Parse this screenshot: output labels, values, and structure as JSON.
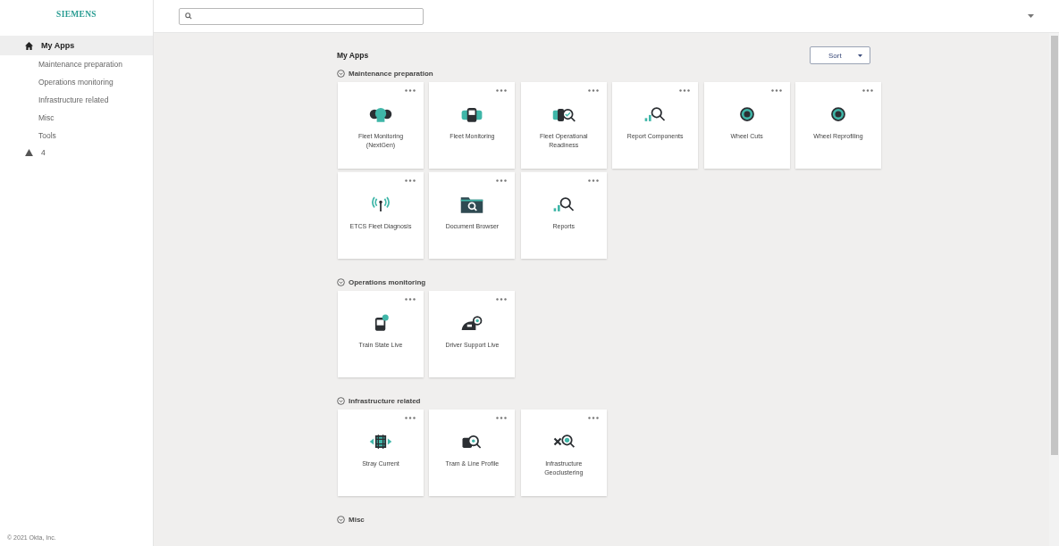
{
  "sidebar": {
    "logo": "SIEMENS",
    "items": [
      {
        "label": "My Apps",
        "selected": true,
        "children": [
          {
            "label": "Maintenance preparation",
            "selected": false
          },
          {
            "label": "Operations monitoring",
            "selected": false
          },
          {
            "label": "Infrastructure related",
            "selected": false
          },
          {
            "label": "Misc",
            "selected": false
          },
          {
            "label": "Tools",
            "selected": false
          }
        ]
      }
    ],
    "alerts": {
      "count": "4"
    },
    "footer": "© 2021 Okta, Inc."
  },
  "main": {
    "title": "My Apps",
    "sort_button": "Sort",
    "sections": [
      {
        "title": "Maintenance preparation",
        "apps": [
          {
            "label": "Fleet Monitoring (NextGen)"
          },
          {
            "label": "Fleet Monitoring"
          },
          {
            "label": "Fleet Operational Readiness"
          },
          {
            "label": "Report Components"
          },
          {
            "label": "Wheel Cuts"
          },
          {
            "label": "Wheel Reprofiling"
          },
          {
            "label": "ETCS Fleet Diagnosis"
          },
          {
            "label": "Document Browser"
          },
          {
            "label": "Reports"
          }
        ]
      },
      {
        "title": "Operations monitoring",
        "apps": [
          {
            "label": "Train State Live"
          },
          {
            "label": "Driver Support Live"
          }
        ]
      },
      {
        "title": "Infrastructure related",
        "apps": [
          {
            "label": "Stray Current"
          },
          {
            "label": "Tram & Line Profile"
          },
          {
            "label": "Infrastructure Geoclustering"
          }
        ]
      },
      {
        "title": "Misc"
      }
    ]
  }
}
